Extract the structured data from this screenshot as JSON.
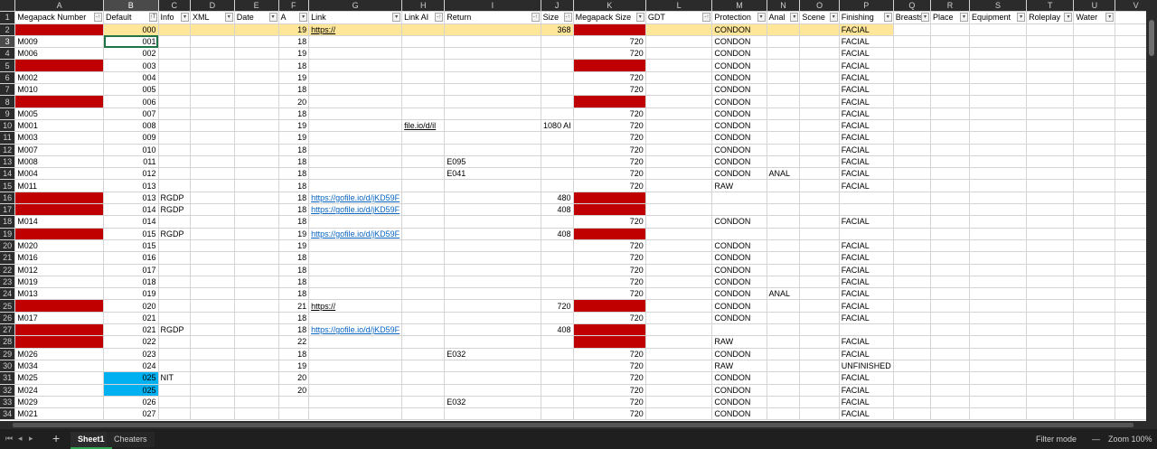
{
  "columns": [
    "A",
    "B",
    "C",
    "D",
    "E",
    "F",
    "G",
    "H",
    "I",
    "J",
    "K",
    "L",
    "M",
    "N",
    "O",
    "P",
    "Q",
    "R",
    "S",
    "T",
    "U",
    "V"
  ],
  "headers": [
    "Megapack Number",
    "Default",
    "Info",
    "XML",
    "Date",
    "A",
    "Link",
    "Link AI",
    "Return",
    "Size",
    "Megapack Size",
    "GDT",
    "Protection",
    "Anal",
    "Scene",
    "Finishing",
    "Breasts",
    "Place",
    "Equipment",
    "Roleplay",
    "Water",
    ""
  ],
  "filter_marks": [
    "-↑",
    "↑T",
    "▾",
    "▾",
    "▾",
    "▾",
    "▾",
    "-↑",
    "-↑",
    "-↑",
    "▾",
    "-↑",
    "▾",
    "▾",
    "▾",
    "▾",
    "▾",
    "▾",
    "▾",
    "▾",
    "▾",
    ""
  ],
  "rows": [
    {
      "n": "2",
      "fill": "yel",
      "A": "",
      "Ared": true,
      "B": "000",
      "F": "19",
      "G": "https://",
      "Gul": true,
      "J": "368",
      "Kred": true,
      "M": "CONDON",
      "P": "FACIAL"
    },
    {
      "n": "3",
      "A": "M009",
      "B": "001",
      "F": "18",
      "K": "720",
      "M": "CONDON",
      "P": "FACIAL",
      "sel": true
    },
    {
      "n": "4",
      "A": "M006",
      "B": "002",
      "F": "19",
      "K": "720",
      "M": "CONDON",
      "P": "FACIAL"
    },
    {
      "n": "5",
      "Ared": true,
      "B": "003",
      "F": "18",
      "Kred": true,
      "M": "CONDON",
      "P": "FACIAL"
    },
    {
      "n": "6",
      "A": "M002",
      "B": "004",
      "F": "19",
      "K": "720",
      "M": "CONDON",
      "P": "FACIAL"
    },
    {
      "n": "7",
      "A": "M010",
      "B": "005",
      "F": "18",
      "K": "720",
      "M": "CONDON",
      "P": "FACIAL"
    },
    {
      "n": "8",
      "Ared": true,
      "B": "006",
      "F": "20",
      "Kred": true,
      "M": "CONDON",
      "P": "FACIAL"
    },
    {
      "n": "9",
      "A": "M005",
      "B": "007",
      "F": "18",
      "K": "720",
      "M": "CONDON",
      "P": "FACIAL"
    },
    {
      "n": "10",
      "A": "M001",
      "B": "008",
      "F": "19",
      "H": "file.io/d/il",
      "Hul": true,
      "J": "1080 AI",
      "K": "720",
      "M": "CONDON",
      "P": "FACIAL"
    },
    {
      "n": "11",
      "A": "M003",
      "B": "009",
      "F": "19",
      "K": "720",
      "M": "CONDON",
      "P": "FACIAL"
    },
    {
      "n": "12",
      "A": "M007",
      "B": "010",
      "F": "18",
      "K": "720",
      "M": "CONDON",
      "P": "FACIAL"
    },
    {
      "n": "13",
      "A": "M008",
      "B": "011",
      "F": "18",
      "I": "E095",
      "K": "720",
      "M": "CONDON",
      "P": "FACIAL"
    },
    {
      "n": "14",
      "A": "M004",
      "B": "012",
      "F": "18",
      "I": "E041",
      "K": "720",
      "M": "CONDON",
      "N": "ANAL",
      "P": "FACIAL"
    },
    {
      "n": "15",
      "A": "M011",
      "B": "013",
      "F": "18",
      "K": "720",
      "M": "RAW",
      "P": "FACIAL"
    },
    {
      "n": "16",
      "Ared": true,
      "B": "013",
      "C": "RGDP",
      "F": "18",
      "G": "https://gofile.io/d/jKD59F",
      "Glnk": true,
      "J": "480",
      "Kred": true
    },
    {
      "n": "17",
      "Ared": true,
      "B": "014",
      "C": "RGDP",
      "F": "18",
      "G": "https://gofile.io/d/jKD59F",
      "Glnk": true,
      "J": "408",
      "Kred": true
    },
    {
      "n": "18",
      "A": "M014",
      "B": "014",
      "F": "18",
      "K": "720",
      "M": "CONDON",
      "P": "FACIAL"
    },
    {
      "n": "19",
      "Ared": true,
      "B": "015",
      "C": "RGDP",
      "F": "19",
      "G": "https://gofile.io/d/jKD59F",
      "Glnk": true,
      "J": "408",
      "Kred": true
    },
    {
      "n": "20",
      "A": "M020",
      "B": "015",
      "F": "19",
      "K": "720",
      "M": "CONDON",
      "P": "FACIAL"
    },
    {
      "n": "21",
      "A": "M016",
      "B": "016",
      "F": "18",
      "K": "720",
      "M": "CONDON",
      "P": "FACIAL"
    },
    {
      "n": "22",
      "A": "M012",
      "B": "017",
      "F": "18",
      "K": "720",
      "M": "CONDON",
      "P": "FACIAL"
    },
    {
      "n": "23",
      "A": "M019",
      "B": "018",
      "F": "18",
      "K": "720",
      "M": "CONDON",
      "P": "FACIAL"
    },
    {
      "n": "24",
      "A": "M013",
      "B": "019",
      "F": "18",
      "K": "720",
      "M": "CONDON",
      "N": "ANAL",
      "P": "FACIAL"
    },
    {
      "n": "25",
      "Ared": true,
      "B": "020",
      "F": "21",
      "G": "https://",
      "Gul": true,
      "J": "720",
      "Kred": true,
      "M": "CONDON",
      "P": "FACIAL"
    },
    {
      "n": "26",
      "A": "M017",
      "B": "021",
      "F": "18",
      "K": "720",
      "M": "CONDON",
      "P": "FACIAL"
    },
    {
      "n": "27",
      "Ared": true,
      "B": "021",
      "C": "RGDP",
      "F": "18",
      "G": "https://gofile.io/d/jKD59F",
      "Glnk": true,
      "J": "408",
      "Kred": true
    },
    {
      "n": "28",
      "Ared": true,
      "B": "022",
      "F": "22",
      "Kred": true,
      "M": "RAW",
      "P": "FACIAL"
    },
    {
      "n": "29",
      "A": "M026",
      "B": "023",
      "F": "18",
      "I": "E032",
      "K": "720",
      "M": "CONDON",
      "P": "FACIAL"
    },
    {
      "n": "30",
      "A": "M034",
      "B": "024",
      "F": "19",
      "K": "720",
      "M": "RAW",
      "P": "UNFINISHED"
    },
    {
      "n": "31",
      "A": "M025",
      "Bblue": true,
      "B": "025",
      "C": "NIT",
      "F": "20",
      "K": "720",
      "M": "CONDON",
      "P": "FACIAL"
    },
    {
      "n": "32",
      "A": "M024",
      "Bblue": true,
      "B": "025",
      "F": "20",
      "K": "720",
      "M": "CONDON",
      "P": "FACIAL"
    },
    {
      "n": "33",
      "A": "M029",
      "B": "026",
      "I": "E032",
      "K": "720",
      "M": "CONDON",
      "P": "FACIAL"
    },
    {
      "n": "34",
      "A": "M021",
      "B": "027",
      "K": "720",
      "M": "CONDON",
      "P": "FACIAL"
    }
  ],
  "tabs": [
    "Sheet1",
    "Cheaters"
  ],
  "status": {
    "filter_mode": "Filter mode",
    "zoom": "Zoom 100%",
    "zoom_out": "—"
  },
  "nav": {
    "first": "⏮",
    "prev": "◂",
    "next": "▸",
    "add": "+"
  },
  "colors": {
    "red": "#c00000",
    "yellow": "#ffe699",
    "blue": "#00b0f0",
    "link": "#0563c1",
    "accent": "#217346"
  }
}
